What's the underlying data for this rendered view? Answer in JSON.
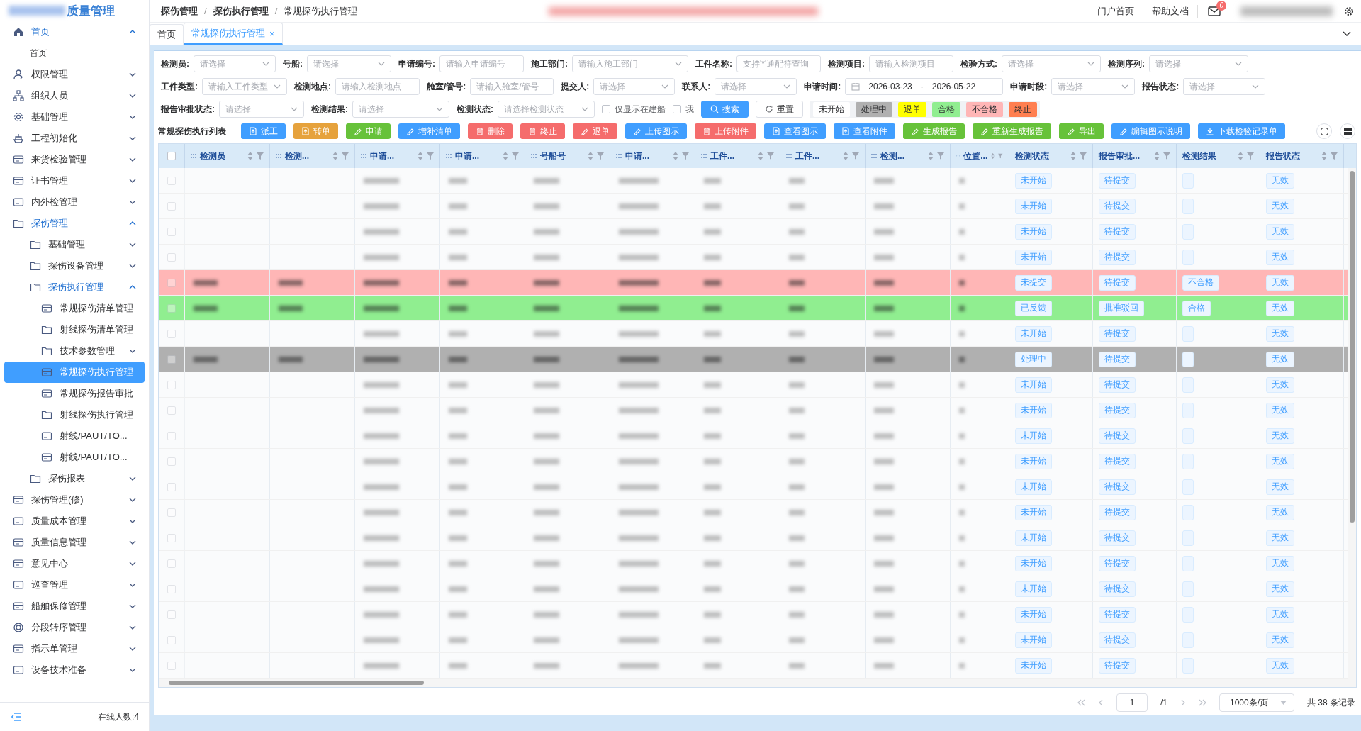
{
  "sidebar": {
    "logo": "质量管理",
    "items": [
      {
        "label": "首页",
        "expanded": true,
        "selected": false,
        "children": [
          {
            "label": "首页",
            "selected": false
          }
        ]
      },
      {
        "label": "权限管理",
        "expanded": false,
        "selected": false
      },
      {
        "label": "组织人员",
        "expanded": false,
        "selected": false
      },
      {
        "label": "基础管理",
        "expanded": false,
        "selected": false
      },
      {
        "label": "工程初始化",
        "expanded": false,
        "selected": false
      },
      {
        "label": "来货检验管理",
        "expanded": false,
        "selected": false
      },
      {
        "label": "证书管理",
        "expanded": false,
        "selected": false
      },
      {
        "label": "内外检管理",
        "expanded": false,
        "selected": false
      },
      {
        "label": "探伤管理",
        "expanded": true,
        "selected": false,
        "children": [
          {
            "label": "基础管理",
            "expanded": false,
            "selected": false
          },
          {
            "label": "探伤设备管理",
            "expanded": false,
            "selected": false
          },
          {
            "label": "探伤执行管理",
            "expanded": true,
            "selected": false,
            "children": [
              {
                "label": "常规探伤清单管理",
                "selected": false
              },
              {
                "label": "射线探伤清单管理",
                "selected": false
              },
              {
                "label": "技术参数管理",
                "expanded": false,
                "selected": false
              },
              {
                "label": "常规探伤执行管理",
                "selected": true
              },
              {
                "label": "常规探伤报告审批",
                "selected": false
              },
              {
                "label": "射线探伤执行管理",
                "selected": false
              },
              {
                "label": "射线/PAUT/TO...",
                "selected": false
              },
              {
                "label": "射线/PAUT/TO...",
                "selected": false
              }
            ]
          },
          {
            "label": "探伤报表",
            "expanded": false,
            "selected": false
          }
        ]
      },
      {
        "label": "探伤管理(修)",
        "expanded": false,
        "selected": false
      },
      {
        "label": "质量成本管理",
        "expanded": false,
        "selected": false
      },
      {
        "label": "质量信息管理",
        "expanded": false,
        "selected": false
      },
      {
        "label": "意见中心",
        "expanded": false,
        "selected": false
      },
      {
        "label": "巡查管理",
        "expanded": false,
        "selected": false
      },
      {
        "label": "船舶保修管理",
        "expanded": false,
        "selected": false
      },
      {
        "label": "分段转序管理",
        "expanded": false,
        "selected": false
      },
      {
        "label": "指示单管理",
        "expanded": false,
        "selected": false
      },
      {
        "label": "设备技术准备",
        "expanded": false,
        "selected": false
      }
    ],
    "online": "在线人数:4"
  },
  "breadcrumb": [
    "探伤管理",
    "/",
    "探伤执行管理",
    "/",
    "常规探伤执行管理"
  ],
  "header_links": [
    "门户首页",
    "帮助文档"
  ],
  "mail_badge": "0",
  "tabs": [
    {
      "label": "首页",
      "selected": false
    },
    {
      "label": "常规探伤执行管理",
      "selected": true,
      "close": "×"
    }
  ],
  "filters": [
    [
      {
        "kind": "select",
        "label": "检测员:",
        "placeholder": "请选择"
      },
      {
        "kind": "select",
        "label": "号船:",
        "placeholder": "请选择"
      },
      {
        "kind": "input",
        "label": "申请编号:",
        "placeholder": "请输入申请编号"
      },
      {
        "kind": "select",
        "label": "施工部门:",
        "placeholder": "请输入施工部门"
      },
      {
        "kind": "input",
        "label": "工件名称:",
        "placeholder": "支持'*'通配符查询"
      },
      {
        "kind": "input",
        "label": "检测项目:",
        "placeholder": "请输入检测项目"
      },
      {
        "kind": "select",
        "label": "检验方式:",
        "placeholder": "请选择"
      },
      {
        "kind": "select",
        "label": "检测序列:",
        "placeholder": "请选择"
      }
    ],
    [
      {
        "kind": "select",
        "label": "工件类型:",
        "placeholder": "请输入工件类型"
      },
      {
        "kind": "input",
        "label": "检测地点:",
        "placeholder": "请输入检测地点"
      },
      {
        "kind": "input",
        "label": "舱室/管号:",
        "placeholder": "请输入舱室/管号"
      },
      {
        "kind": "select",
        "label": "提交人:",
        "placeholder": "请选择"
      },
      {
        "kind": "select",
        "label": "联系人:",
        "placeholder": "请选择"
      },
      {
        "kind": "daterange",
        "label": "申请时间:",
        "start": "2026-03-23",
        "sep": "-",
        "end": "2026-05-22"
      },
      {
        "kind": "select",
        "label": "申请时段:",
        "placeholder": "请选择"
      },
      {
        "kind": "select",
        "label": "报告状态:",
        "placeholder": "请选择"
      }
    ],
    [
      {
        "kind": "select",
        "label": "报告审批状态:",
        "placeholder": "请选择"
      },
      {
        "kind": "select",
        "label": "检测结果:",
        "placeholder": "请选择"
      },
      {
        "kind": "select",
        "label": "检测状态:",
        "placeholder": "请选择检测状态"
      },
      {
        "kind": "checkbox",
        "label": "仅显示在建船",
        "checked": false
      },
      {
        "kind": "checkbox",
        "label": "我",
        "checked": false
      },
      {
        "kind": "search",
        "label": "搜索"
      },
      {
        "kind": "reset",
        "label": "重置"
      }
    ]
  ],
  "legend": [
    {
      "label": "未开始",
      "color": "#ffffff"
    },
    {
      "label": "处理中",
      "color": "#b0b0b0"
    },
    {
      "label": "退单",
      "color": "#ffff00"
    },
    {
      "label": "合格",
      "color": "#90ee90"
    },
    {
      "label": "不合格",
      "color": "#ffb6b6"
    },
    {
      "label": "终止",
      "color": "#ff7f50"
    }
  ],
  "toolbar": {
    "title": "常规探伤执行列表",
    "buttons": [
      {
        "label": "派工",
        "kind": "primary"
      },
      {
        "label": "转单",
        "kind": "warning"
      },
      {
        "label": "申请",
        "kind": "success"
      },
      {
        "label": "增补清单",
        "kind": "primary"
      },
      {
        "label": "删除",
        "kind": "danger"
      },
      {
        "label": "终止",
        "kind": "danger"
      },
      {
        "label": "退单",
        "kind": "danger"
      },
      {
        "label": "上传图示",
        "kind": "primary"
      },
      {
        "label": "上传附件",
        "kind": "danger"
      },
      {
        "label": "查看图示",
        "kind": "primary"
      },
      {
        "label": "查看附件",
        "kind": "primary"
      },
      {
        "label": "生成报告",
        "kind": "success"
      },
      {
        "label": "重新生成报告",
        "kind": "success"
      },
      {
        "label": "导出",
        "kind": "success"
      },
      {
        "label": "编辑图示说明",
        "kind": "primary"
      },
      {
        "label": "下载检验记录单",
        "kind": "primary"
      }
    ]
  },
  "table": {
    "select_all_checked": false,
    "columns": [
      {
        "label": "检测员",
        "draggable": true
      },
      {
        "label": "检测...",
        "draggable": true
      },
      {
        "label": "申请...",
        "draggable": true
      },
      {
        "label": "申请...",
        "draggable": true
      },
      {
        "label": "号船号",
        "draggable": true
      },
      {
        "label": "申请...",
        "draggable": true
      },
      {
        "label": "工件...",
        "draggable": true
      },
      {
        "label": "工件...",
        "draggable": true
      },
      {
        "label": "检测...",
        "draggable": true
      },
      {
        "label": "位置...",
        "draggable": true
      },
      {
        "label": "检测状态",
        "draggable": false
      },
      {
        "label": "报告审批...",
        "draggable": false
      },
      {
        "label": "检测结果",
        "draggable": false
      },
      {
        "label": "报告状态",
        "draggable": false
      }
    ],
    "rows": [
      {
        "checked": false,
        "status": "未开始",
        "approval": "待提交",
        "report": "无效"
      },
      {
        "checked": false,
        "status": "未开始",
        "approval": "待提交",
        "report": "无效"
      },
      {
        "checked": false,
        "status": "未开始",
        "approval": "待提交",
        "report": "无效"
      },
      {
        "checked": false,
        "status": "未开始",
        "approval": "待提交",
        "report": "无效"
      },
      {
        "checked": false,
        "color": "#ffb6b6",
        "status": "未提交",
        "approval": "待提交",
        "result": "不合格",
        "report": "无效"
      },
      {
        "checked": false,
        "color": "#90ee90",
        "status": "已反馈",
        "approval": "批准驳回",
        "result": "合格",
        "report": "无效"
      },
      {
        "checked": false,
        "status": "未开始",
        "approval": "待提交",
        "report": "无效"
      },
      {
        "checked": false,
        "color": "#b0b0b0",
        "status": "处理中",
        "approval": "待提交",
        "report": "无效"
      },
      {
        "checked": false,
        "status": "未开始",
        "approval": "待提交",
        "report": "无效"
      },
      {
        "checked": false,
        "status": "未开始",
        "approval": "待提交",
        "report": "无效"
      },
      {
        "checked": false,
        "status": "未开始",
        "approval": "待提交",
        "report": "无效"
      },
      {
        "checked": false,
        "status": "未开始",
        "approval": "待提交",
        "report": "无效"
      },
      {
        "checked": false,
        "status": "未开始",
        "approval": "待提交",
        "report": "无效"
      },
      {
        "checked": false,
        "status": "未开始",
        "approval": "待提交",
        "report": "无效"
      },
      {
        "checked": false,
        "status": "未开始",
        "approval": "待提交",
        "report": "无效"
      },
      {
        "checked": false,
        "status": "未开始",
        "approval": "待提交",
        "report": "无效"
      },
      {
        "checked": false,
        "status": "未开始",
        "approval": "待提交",
        "report": "无效"
      },
      {
        "checked": false,
        "status": "未开始",
        "approval": "待提交",
        "report": "无效"
      },
      {
        "checked": false,
        "status": "未开始",
        "approval": "待提交",
        "report": "无效"
      },
      {
        "checked": false,
        "status": "未开始",
        "approval": "待提交",
        "report": "无效"
      }
    ]
  },
  "pagination": {
    "page": "1",
    "total_pages": "/1",
    "page_size": "1000条/页",
    "summary": "共 38 条记录"
  }
}
